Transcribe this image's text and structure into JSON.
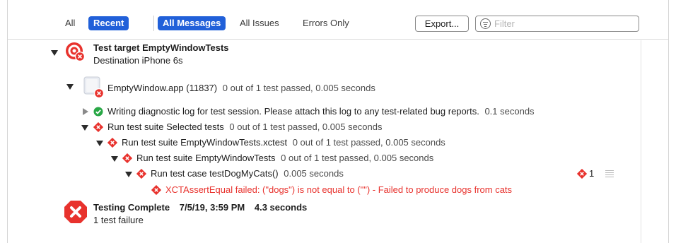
{
  "toolbar": {
    "filter_all": "All",
    "filter_recent": "Recent",
    "scope_all_messages": "All Messages",
    "scope_all_issues": "All Issues",
    "scope_errors_only": "Errors Only",
    "export_label": "Export...",
    "filter_placeholder": "Filter"
  },
  "log": {
    "target": {
      "title": "Test target EmptyWindowTests",
      "destination": "Destination iPhone 6s"
    },
    "app": {
      "name": "EmptyWindow.app (11837)",
      "summary": "0 out of 1 test passed, 0.005 seconds"
    },
    "diagnostic": {
      "text": "Writing diagnostic log for test session. Please attach this log to any test-related bug reports.",
      "duration": "0.1 seconds"
    },
    "suite_selected": {
      "name": "Run test suite Selected tests",
      "summary": "0 out of 1 test passed, 0.005 seconds"
    },
    "suite_xctest": {
      "name": "Run test suite EmptyWindowTests.xctest",
      "summary": "0 out of 1 test passed, 0.005 seconds"
    },
    "suite_tests": {
      "name": "Run test suite EmptyWindowTests",
      "summary": "0 out of 1 test passed, 0.005 seconds"
    },
    "test_case": {
      "name": "Run test case testDogMyCats()",
      "duration": "0.005 seconds",
      "issue_count": "1"
    },
    "failure": {
      "message": "XCTAssertEqual failed: (\"dogs\") is not equal to (\"\") - Failed to produce dogs from cats"
    },
    "complete": {
      "title": "Testing Complete",
      "date": "7/5/19, 3:59 PM",
      "duration": "4.3 seconds",
      "result": "1 test failure"
    }
  },
  "colors": {
    "accent": "#2160d9",
    "error": "#e8322d",
    "success": "#28a745"
  }
}
